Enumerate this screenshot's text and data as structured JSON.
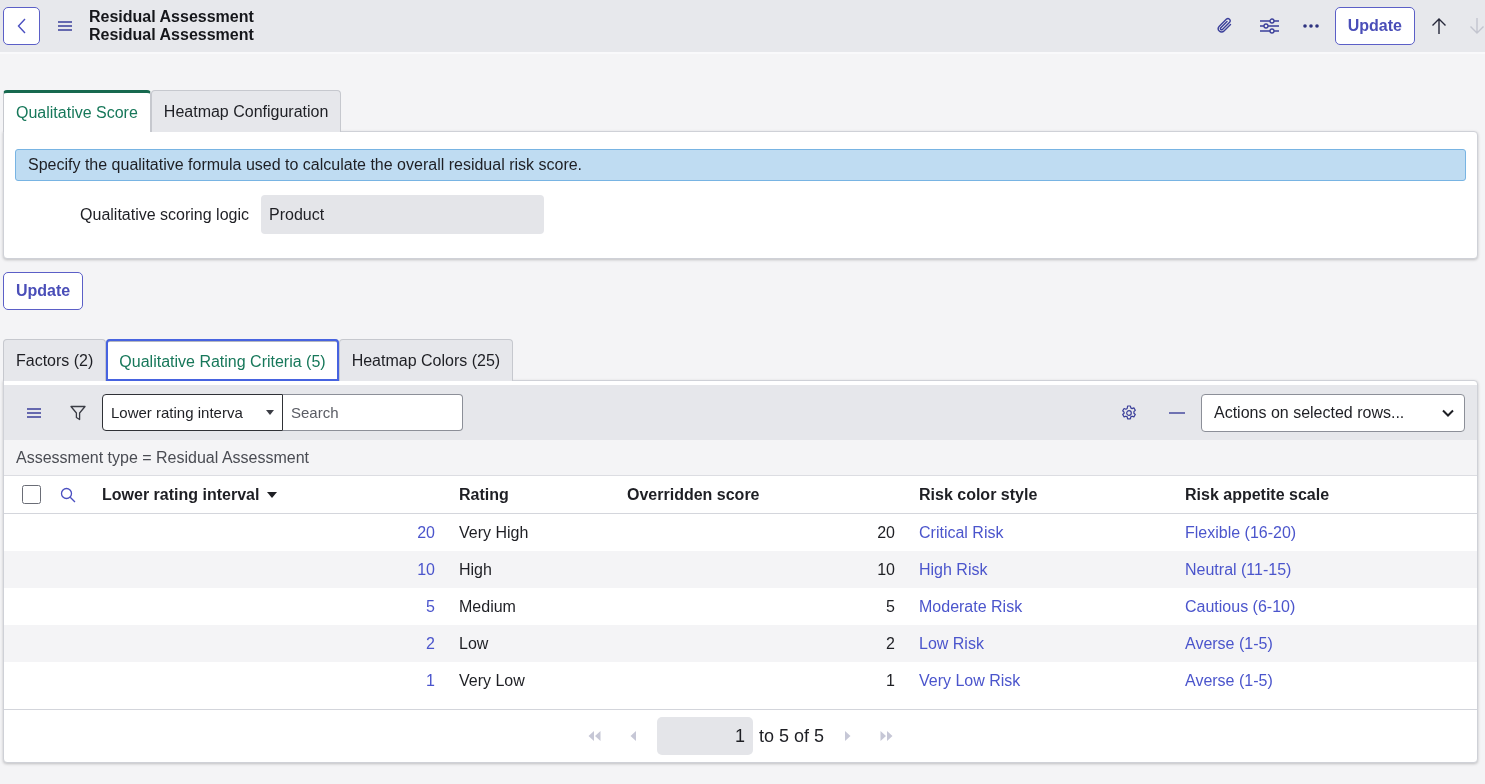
{
  "header": {
    "titles": [
      "Residual Assessment",
      "Residual Assessment"
    ],
    "update_button": "Update",
    "nav": [
      {
        "kind": "up",
        "disabled": false
      },
      {
        "kind": "down",
        "disabled": true
      }
    ]
  },
  "form_tabs": [
    {
      "label": "Qualitative Score",
      "selected": true
    },
    {
      "label": "Heatmap Configuration",
      "selected": false
    }
  ],
  "form": {
    "info": "Specify the qualitative formula used to calculate the overall residual risk score.",
    "fields": [
      {
        "label": "Qualitative scoring logic",
        "value": "Product"
      }
    ]
  },
  "update_button": "Update",
  "related_tabs": [
    {
      "label": "Factors (2)",
      "selected": false,
      "focused": false
    },
    {
      "label": "Qualitative Rating Criteria (5)",
      "selected": true,
      "focused": true
    },
    {
      "label": "Heatmap Colors (25)",
      "selected": false,
      "focused": false
    }
  ],
  "list": {
    "toolbar": {
      "search_column": "Lower rating interva",
      "search_placeholder": "Search",
      "actions": "Actions on selected rows..."
    },
    "breadcrumb": "Assessment type = Residual Assessment",
    "select_all": {
      "checked": false
    },
    "columns": [
      {
        "label": "Lower rating interval",
        "kind": "number_link",
        "sorted": true
      },
      {
        "label": "Rating",
        "kind": "text",
        "sorted": false
      },
      {
        "label": "Overridden score",
        "kind": "number",
        "sorted": false
      },
      {
        "label": "Risk color style",
        "kind": "link",
        "sorted": false
      },
      {
        "label": "Risk appetite scale",
        "kind": "link",
        "sorted": false
      }
    ],
    "rows": [
      [
        "20",
        "Very High",
        "20",
        "Critical Risk",
        "Flexible (16-20)"
      ],
      [
        "10",
        "High",
        "10",
        "High Risk",
        "Neutral (11-15)"
      ],
      [
        "5",
        "Medium",
        "5",
        "Moderate Risk",
        "Cautious (6-10)"
      ],
      [
        "2",
        "Low",
        "2",
        "Low Risk",
        "Averse (1-5)"
      ],
      [
        "1",
        "Very Low",
        "1",
        "Very Low Risk",
        "Averse (1-5)"
      ]
    ],
    "pagination": {
      "buttons": [
        {
          "kind": "first",
          "disabled": true
        },
        {
          "kind": "prev",
          "disabled": true
        },
        {
          "kind": "next",
          "disabled": true
        },
        {
          "kind": "last",
          "disabled": true
        }
      ],
      "page": "1",
      "range": "to 5 of 5"
    }
  }
}
